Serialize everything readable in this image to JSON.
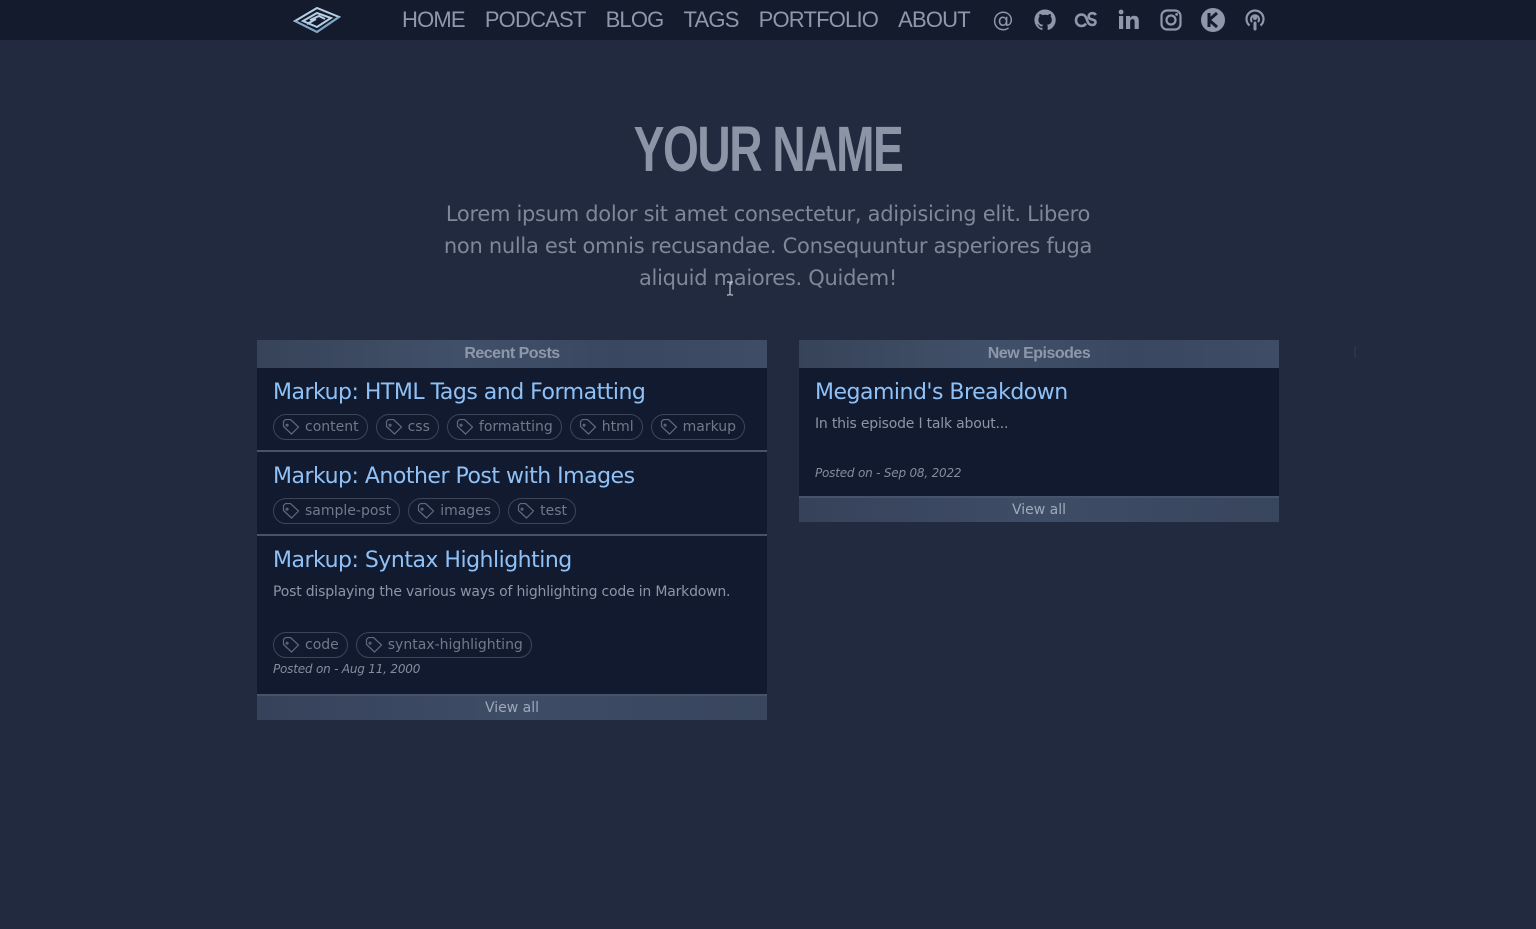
{
  "nav": {
    "links": [
      "HOME",
      "PODCAST",
      "BLOG",
      "TAGS",
      "PORTFOLIO",
      "ABOUT"
    ],
    "social_icons": [
      "email-icon",
      "github-icon",
      "lastfm-icon",
      "linkedin-icon",
      "instagram-icon",
      "keybase-icon",
      "podcast-icon"
    ]
  },
  "hero": {
    "title": "YOUR NAME",
    "subtitle": "Lorem ipsum dolor sit amet consectetur, adipisicing elit. Libero non nulla est omnis recusandae. Consequuntur asperiores fuga aliquid maiores. Quidem!"
  },
  "recent_posts": {
    "header": "Recent Posts",
    "footer": "View all",
    "posts": [
      {
        "title": "Markup: HTML Tags and Formatting",
        "tags": [
          "content",
          "css",
          "formatting",
          "html",
          "markup"
        ]
      },
      {
        "title": "Markup: Another Post with Images",
        "tags": [
          "sample-post",
          "images",
          "test"
        ]
      },
      {
        "title": "Markup: Syntax Highlighting",
        "description": "Post displaying the various ways of highlighting code in Markdown.",
        "tags": [
          "code",
          "syntax-highlighting"
        ],
        "posted": "Posted on - Aug 11, 2000"
      }
    ]
  },
  "new_episodes": {
    "header": "New Episodes",
    "footer": "View all",
    "episodes": [
      {
        "title": "Megamind's Breakdown",
        "description": "In this episode I talk about...",
        "posted": "Posted on - Sep 08, 2022"
      }
    ]
  },
  "colors": {
    "background": "#212a3e",
    "navbar": "#131b2c",
    "link": "#8fc1f7",
    "panel": "#111a2e"
  }
}
